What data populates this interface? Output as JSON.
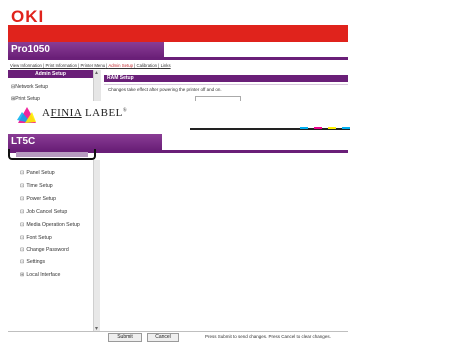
{
  "brand": {
    "logo": "OKI",
    "model": "Pro1050"
  },
  "top_nav": {
    "items": [
      {
        "label": "View Information",
        "highlight": false
      },
      {
        "label": "Print Information",
        "highlight": false
      },
      {
        "label": "Printer Menu",
        "highlight": false
      },
      {
        "label": "Admin Setup",
        "highlight": true
      },
      {
        "label": "Calibration",
        "highlight": false
      },
      {
        "label": "Links",
        "highlight": false
      }
    ],
    "separator": " | "
  },
  "old_sidebar": {
    "header": "Admin Setup",
    "item": "Network Setup",
    "item2": "Print Setup"
  },
  "ram_panel": {
    "title": "RAM Setup",
    "note": "Changes take effect after powering the printer off and on."
  },
  "overlay": {
    "logo_prefix": "A",
    "logo_mid": "FINIA",
    "logo_suffix": " LABEL",
    "mark": "®"
  },
  "product": {
    "name": "LT5C"
  },
  "sidebar": {
    "items": [
      {
        "label": "Panel Setup",
        "bullet": "⊡"
      },
      {
        "label": "Time Setup",
        "bullet": "⊡"
      },
      {
        "label": "Power Setup",
        "bullet": "⊡"
      },
      {
        "label": "Job Cancel Setup",
        "bullet": "⊡"
      },
      {
        "label": "Media Operation Setup",
        "bullet": "⊡"
      },
      {
        "label": "Font Setup",
        "bullet": "⊡"
      },
      {
        "label": "Change Password",
        "bullet": "⊡"
      },
      {
        "label": "Settings",
        "bullet": "⊡"
      },
      {
        "label": "Local Interface",
        "bullet": "⊞"
      }
    ]
  },
  "footer": {
    "submit_label": "Submit",
    "cancel_label": "Cancel",
    "note": "Press Submit to send changes. Press Cancel to clear changes."
  },
  "colors": {
    "oki_red": "#e0231c",
    "purple": "#6a1f78",
    "cyan": "#00aeef",
    "magenta": "#ec008c",
    "yellow": "#fff200"
  }
}
